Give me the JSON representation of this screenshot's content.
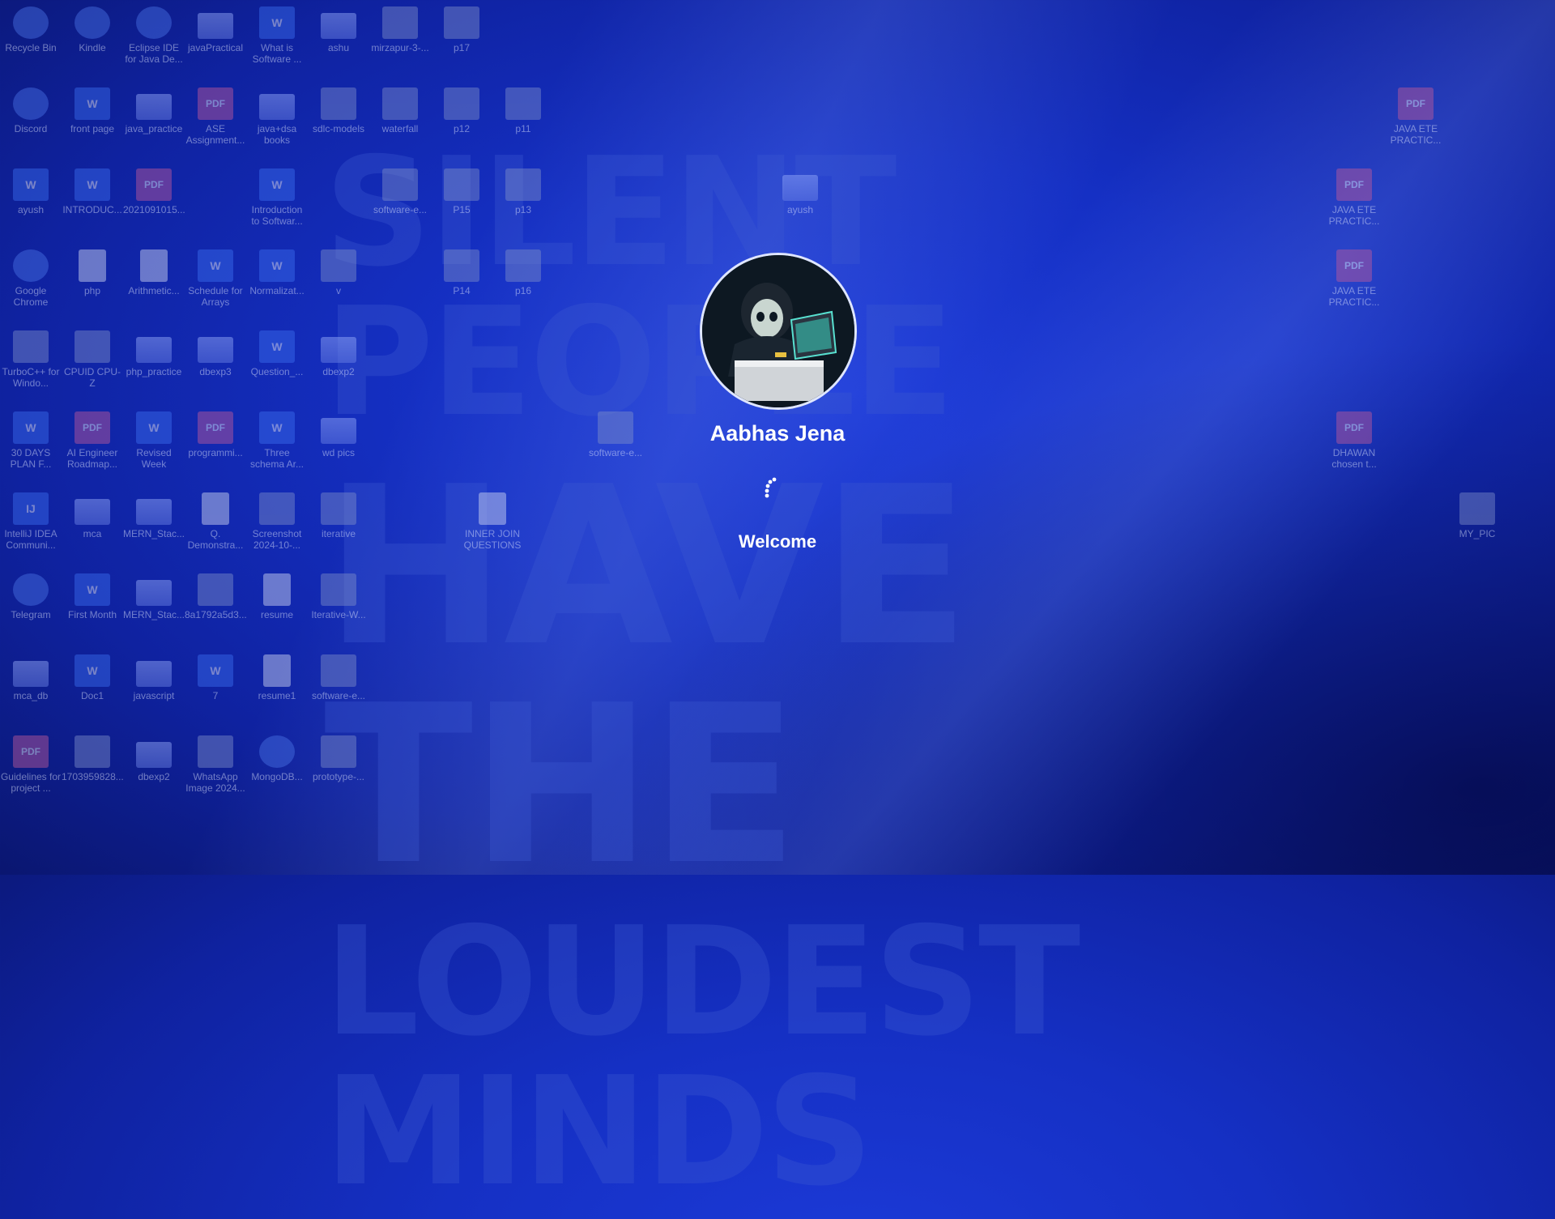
{
  "wallpaper": {
    "line1": "SILENT PEOPLE",
    "line2": "HAVE THE",
    "line3": "LOUDEST MINDS"
  },
  "desktop_icons": [
    {
      "label": "Recycle Bin",
      "icon": "recycle-bin-icon"
    },
    {
      "label": "Kindle",
      "icon": "kindle-icon"
    },
    {
      "label": "Eclipse IDE for Java De...",
      "icon": "eclipse-icon"
    },
    {
      "label": "javaPractical",
      "icon": "folder-icon"
    },
    {
      "label": "What is Software ...",
      "icon": "word-icon"
    },
    {
      "label": "ashu",
      "icon": "folder-icon"
    },
    {
      "label": "mirzapur-3-...",
      "icon": "image-icon"
    },
    {
      "label": "p17",
      "icon": "image-icon"
    },
    {
      "label": "Discord",
      "icon": "discord-icon"
    },
    {
      "label": "front page",
      "icon": "word-icon"
    },
    {
      "label": "java_practice",
      "icon": "folder-icon"
    },
    {
      "label": "ASE Assignment...",
      "icon": "pdf-icon"
    },
    {
      "label": "java+dsa books",
      "icon": "folder-icon"
    },
    {
      "label": "sdlc-models",
      "icon": "image-icon"
    },
    {
      "label": "waterfall",
      "icon": "image-icon"
    },
    {
      "label": "p12",
      "icon": "image-icon"
    },
    {
      "label": "p11",
      "icon": "image-icon"
    },
    {
      "label": "JAVA ETE PRACTIC...",
      "icon": "pdf-icon"
    },
    {
      "label": "ayush",
      "icon": "word-icon"
    },
    {
      "label": "INTRODUC...",
      "icon": "word-icon"
    },
    {
      "label": "2021091015...",
      "icon": "pdf-icon"
    },
    {
      "label": "Introduction to Softwar...",
      "icon": "word-icon"
    },
    {
      "label": "software-e...",
      "icon": "image-icon"
    },
    {
      "label": "P15",
      "icon": "image-icon"
    },
    {
      "label": "p13",
      "icon": "image-icon"
    },
    {
      "label": "ayush",
      "icon": "folder-icon"
    },
    {
      "label": "JAVA ETE PRACTIC...",
      "icon": "pdf-icon"
    },
    {
      "label": "Google Chrome",
      "icon": "chrome-icon"
    },
    {
      "label": "php",
      "icon": "document-icon"
    },
    {
      "label": "Arithmetic...",
      "icon": "document-icon"
    },
    {
      "label": "Schedule for Arrays",
      "icon": "word-icon"
    },
    {
      "label": "Normalizat...",
      "icon": "word-icon"
    },
    {
      "label": "v",
      "icon": "v-icon"
    },
    {
      "label": "P14",
      "icon": "image-icon"
    },
    {
      "label": "p16",
      "icon": "image-icon"
    },
    {
      "label": "JAVA ETE PRACTIC...",
      "icon": "pdf-icon"
    },
    {
      "label": "TurboC++ for Windo...",
      "icon": "turboc-icon"
    },
    {
      "label": "CPUID CPU-Z",
      "icon": "cpuz-icon"
    },
    {
      "label": "php_practice",
      "icon": "folder-icon"
    },
    {
      "label": "dbexp3",
      "icon": "folder-icon"
    },
    {
      "label": "Question_...",
      "icon": "word-icon"
    },
    {
      "label": "dbexp2",
      "icon": "folder-icon"
    },
    {
      "label": "30 DAYS PLAN F...",
      "icon": "word-icon"
    },
    {
      "label": "AI Engineer Roadmap...",
      "icon": "pdf-icon"
    },
    {
      "label": "Revised Week",
      "icon": "word-icon"
    },
    {
      "label": "programmi...",
      "icon": "pdf-icon"
    },
    {
      "label": "Three schema Ar...",
      "icon": "word-icon"
    },
    {
      "label": "wd pics",
      "icon": "folder-icon"
    },
    {
      "label": "software-e...",
      "icon": "v-icon"
    },
    {
      "label": "DHAWAN chosen t...",
      "icon": "pdf-icon"
    },
    {
      "label": "IntelliJ IDEA Communi...",
      "icon": "intellij-icon"
    },
    {
      "label": "mca",
      "icon": "folder-icon"
    },
    {
      "label": "MERN_Stac...",
      "icon": "folder-icon"
    },
    {
      "label": "Q. Demonstra...",
      "icon": "document-icon"
    },
    {
      "label": "Screenshot 2024-10-...",
      "icon": "image-icon"
    },
    {
      "label": "iterative",
      "icon": "image-icon"
    },
    {
      "label": "INNER JOIN QUESTIONS",
      "icon": "document-icon"
    },
    {
      "label": "MY_PIC",
      "icon": "image-icon"
    },
    {
      "label": "Telegram",
      "icon": "telegram-icon"
    },
    {
      "label": "First Month",
      "icon": "word-icon"
    },
    {
      "label": "MERN_Stac...",
      "icon": "folder-icon"
    },
    {
      "label": "8a1792a5d3...",
      "icon": "image-icon"
    },
    {
      "label": "resume",
      "icon": "document-icon"
    },
    {
      "label": "Iterative-W...",
      "icon": "image-icon"
    },
    {
      "label": "mca_db",
      "icon": "folder-icon"
    },
    {
      "label": "Doc1",
      "icon": "word-icon"
    },
    {
      "label": "javascript",
      "icon": "folder-icon"
    },
    {
      "label": "7",
      "icon": "word-icon"
    },
    {
      "label": "resume1",
      "icon": "document-icon"
    },
    {
      "label": "software-e...",
      "icon": "image-icon"
    },
    {
      "label": "Guidelines for project ...",
      "icon": "pdf-icon"
    },
    {
      "label": "1703959828...",
      "icon": "image-icon"
    },
    {
      "label": "dbexp2",
      "icon": "folder-icon"
    },
    {
      "label": "WhatsApp Image 2024...",
      "icon": "image-icon"
    },
    {
      "label": "MongoDB...",
      "icon": "mongodb-icon"
    },
    {
      "label": "prototype-...",
      "icon": "image-icon"
    }
  ],
  "login": {
    "user_name": "Aabhas Jena",
    "status": "Welcome",
    "avatar_icon": "user-avatar-icon",
    "spinner_icon": "loading-spinner-icon"
  },
  "glyphs": {
    "word": "W",
    "pdf": "PDF",
    "intellij": "IJ"
  }
}
